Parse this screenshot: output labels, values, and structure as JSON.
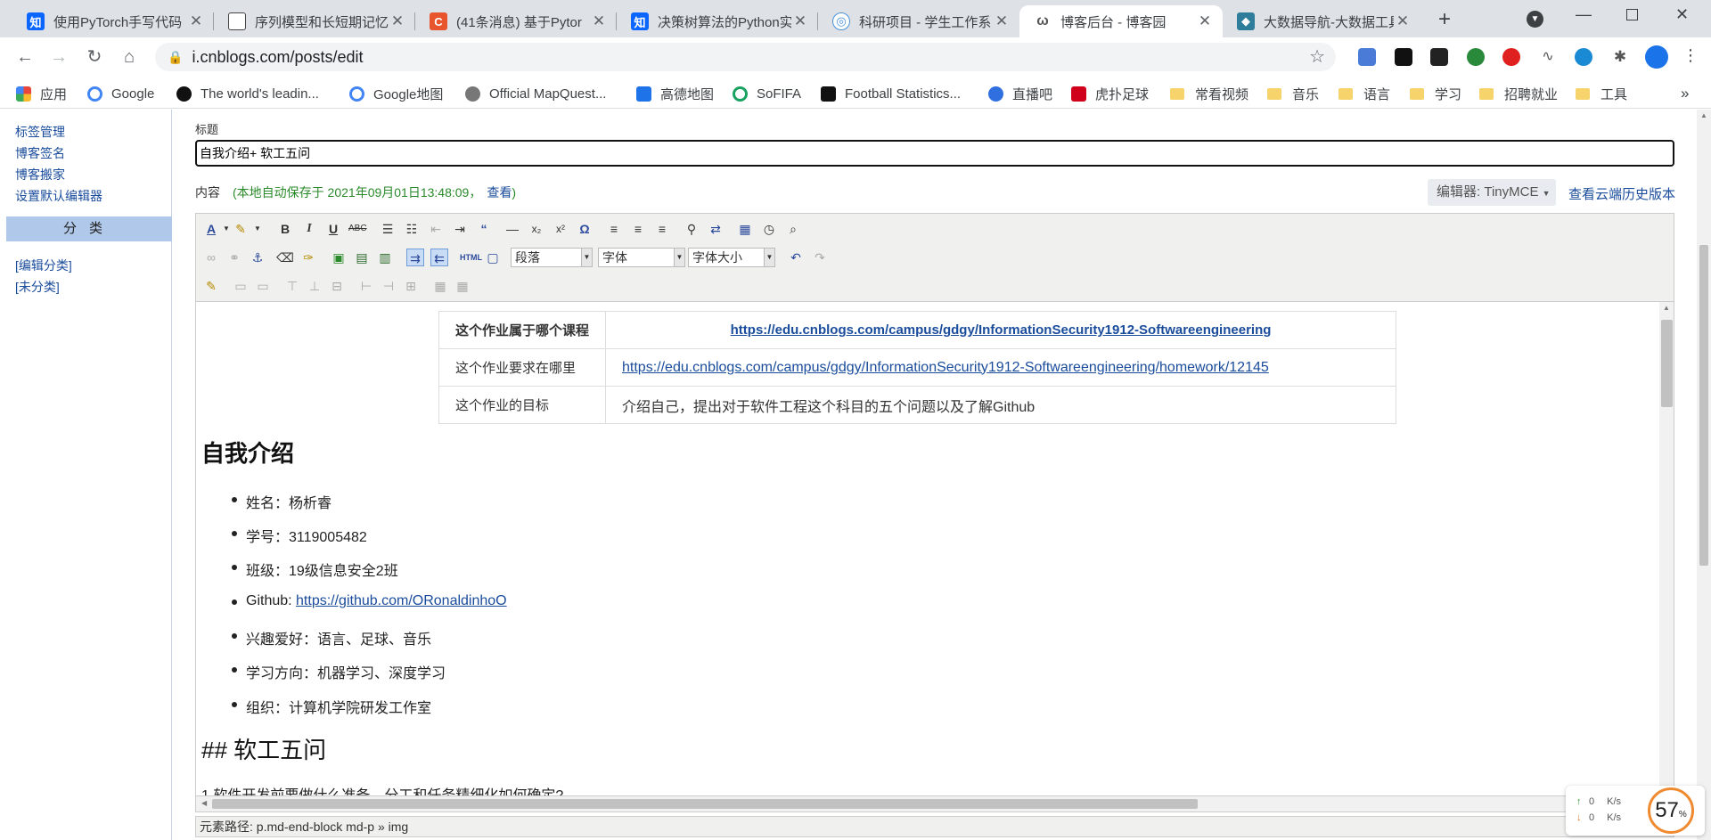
{
  "browser": {
    "tabs": [
      {
        "title": "使用PyTorch手写代码",
        "icon_text": "知",
        "icon_color": "#0a66ff"
      },
      {
        "title": "序列模型和长短期记忆",
        "icon_text": "▇",
        "icon_color": "#444444"
      },
      {
        "title": "(41条消息) 基于Pytor",
        "icon_text": "C",
        "icon_color": "#e8542c"
      },
      {
        "title": "决策树算法的Python实",
        "icon_text": "知",
        "icon_color": "#0a66ff"
      },
      {
        "title": "科研项目 - 学生工作系",
        "icon_text": "◎",
        "icon_color": "#4a90d9"
      },
      {
        "title": "博客后台 - 博客园",
        "icon_text": "ω",
        "icon_color": "#555555"
      },
      {
        "title": "大数据导航-大数据工具",
        "icon_text": "◆",
        "icon_color": "#2e7d9a"
      }
    ],
    "active_tab_index": 5,
    "url": "i.cnblogs.com/posts/edit",
    "bookmarks": [
      {
        "label": "应用",
        "icon": "apps-grid-icon",
        "color": "#e8453c"
      },
      {
        "label": "Google",
        "icon": "google-icon",
        "color": "#4285f4"
      },
      {
        "label": "The world's leadin...",
        "icon": "github-icon",
        "color": "#111111"
      },
      {
        "label": "Google地图",
        "icon": "google-icon",
        "color": "#4285f4"
      },
      {
        "label": "Official MapQuest...",
        "icon": "globe-icon",
        "color": "#666666"
      },
      {
        "label": "高德地图",
        "icon": "amap-icon",
        "color": "#1e73e8"
      },
      {
        "label": "SoFIFA",
        "icon": "sofifa-icon",
        "color": "#19a15f"
      },
      {
        "label": "Football Statistics...",
        "icon": "football-stats-icon",
        "color": "#111111"
      },
      {
        "label": "直播吧",
        "icon": "zhibo8-icon",
        "color": "#2f6fe0"
      },
      {
        "label": "虎扑足球",
        "icon": "hupu-icon",
        "color": "#d0021b"
      },
      {
        "label": "常看视频",
        "icon": "folder-icon",
        "color": "#f6d46b"
      },
      {
        "label": "音乐",
        "icon": "folder-icon",
        "color": "#f6d46b"
      },
      {
        "label": "语言",
        "icon": "folder-icon",
        "color": "#f6d46b"
      },
      {
        "label": "学习",
        "icon": "folder-icon",
        "color": "#f6d46b"
      },
      {
        "label": "招聘就业",
        "icon": "folder-icon",
        "color": "#f6d46b"
      },
      {
        "label": "工具",
        "icon": "folder-icon",
        "color": "#f6d46b"
      }
    ],
    "more_bookmarks": "»"
  },
  "sidebar": {
    "items": [
      "标签管理",
      "博客签名",
      "博客搬家",
      "设置默认编辑器"
    ],
    "category_header": "分类",
    "categories": [
      "[编辑分类]",
      "[未分类]"
    ]
  },
  "editor": {
    "title_label": "标题",
    "title_value": "自我介绍+ 软工五问",
    "content_label": "内容",
    "autosave_text": "(本地自动保存于 2021年09月01日13:48:09，",
    "autosave_link": "查看",
    "autosave_close": ")",
    "editor_select": "编辑器: TinyMCE",
    "history_link": "查看云端历史版本",
    "format_select": "段落",
    "font_select": "字体",
    "size_select": "字体大小",
    "status_path": "元素路径: p.md-end-block md-p » img"
  },
  "content": {
    "table": [
      [
        "这个作业属于哪个课程",
        "https://edu.cnblogs.com/campus/gdgy/InformationSecurity1912-Softwareengineering"
      ],
      [
        "这个作业要求在哪里",
        "https://edu.cnblogs.com/campus/gdgy/InformationSecurity1912-Softwareengineering/homework/12145"
      ],
      [
        "这个作业的目标",
        "介绍自己，提出对于软件工程这个科目的五个问题以及了解Github"
      ]
    ],
    "heading1": "自我介绍",
    "list": [
      {
        "text": "姓名：杨析睿"
      },
      {
        "text": "学号：3119005482"
      },
      {
        "text": "班级：19级信息安全2班"
      },
      {
        "text": "Github: ",
        "link": "https://github.com/ORonaldinhoO"
      },
      {
        "text": "兴趣爱好：语言、足球、音乐"
      },
      {
        "text": "学习方向：机器学习、深度学习"
      },
      {
        "text": "组织：计算机学院研发工作室"
      }
    ],
    "heading2": "## 软工五问",
    "cut_line": "1.软件开发前要做什么准备，分工和任务精细化如何确定?"
  },
  "network": {
    "up": "0",
    "down": "0",
    "unit": "K/s",
    "cpu_percent": "57",
    "percent_sign": "%"
  }
}
